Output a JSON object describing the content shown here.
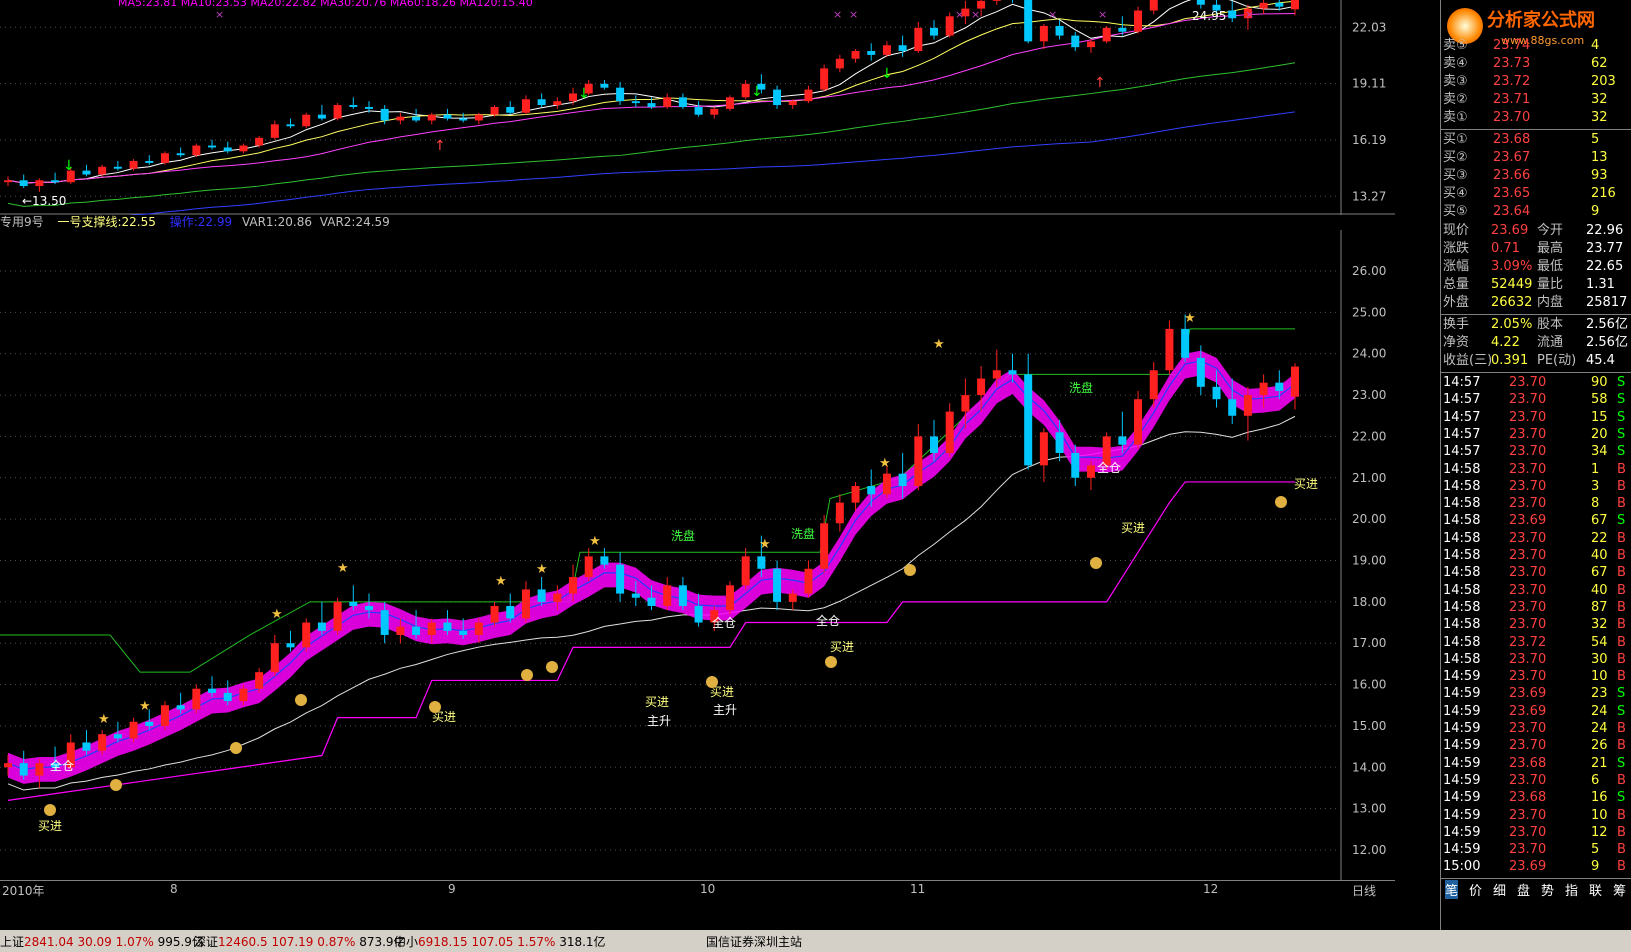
{
  "top_legend": {
    "ma_text": "MA5:23.81  MA10:23.53  MA20:22.82  MA30:20.76  MA60:18.26  MA120:15.40"
  },
  "indicator_legend": {
    "name": "专用9号",
    "support": "一号支撑线:22.55",
    "op": "操作:22.99",
    "var1": "VAR1:20.86",
    "var2": "VAR2:24.59"
  },
  "top_price_axis": [
    "22.03",
    "19.11",
    "16.19",
    "13.27"
  ],
  "main_price_axis": [
    "26.00",
    "25.00",
    "24.00",
    "23.00",
    "22.00",
    "21.00",
    "20.00",
    "19.00",
    "18.00",
    "17.00",
    "16.00",
    "15.00",
    "14.00",
    "13.00",
    "12.00"
  ],
  "low_label": "←13.50",
  "high_label": "24.95",
  "date_axis": [
    "2010年",
    "8",
    "9",
    "10",
    "11",
    "12"
  ],
  "date_axis_right": "日线",
  "annotations": {
    "buy": "买进",
    "full": "全仓",
    "wash": "洗盘",
    "main_rise": "主升"
  },
  "brand": {
    "name": "分析家公式网",
    "url": "www.88gs.com"
  },
  "order_book": {
    "sell": [
      {
        "label": "卖⑤",
        "price": "23.74",
        "vol": "4"
      },
      {
        "label": "卖④",
        "price": "23.73",
        "vol": "62"
      },
      {
        "label": "卖③",
        "price": "23.72",
        "vol": "203"
      },
      {
        "label": "卖②",
        "price": "23.71",
        "vol": "32"
      },
      {
        "label": "卖①",
        "price": "23.70",
        "vol": "32"
      }
    ],
    "buy": [
      {
        "label": "买①",
        "price": "23.68",
        "vol": "5"
      },
      {
        "label": "买②",
        "price": "23.67",
        "vol": "13"
      },
      {
        "label": "买③",
        "price": "23.66",
        "vol": "93"
      },
      {
        "label": "买④",
        "price": "23.65",
        "vol": "216"
      },
      {
        "label": "买⑤",
        "price": "23.64",
        "vol": "9"
      }
    ]
  },
  "stats": [
    {
      "k1": "现价",
      "v1": "23.69",
      "k2": "今开",
      "v2": "22.96"
    },
    {
      "k1": "涨跌",
      "v1": "0.71",
      "k2": "最高",
      "v2": "23.77"
    },
    {
      "k1": "涨幅",
      "v1": "3.09%",
      "k2": "最低",
      "v2": "22.65"
    },
    {
      "k1": "总量",
      "v1": "52449",
      "k2": "量比",
      "v2": "1.31"
    },
    {
      "k1": "外盘",
      "v1": "26632",
      "k2": "内盘",
      "v2": "25817"
    },
    {
      "k1": "换手",
      "v1": "2.05%",
      "k2": "股本",
      "v2": "2.56亿"
    },
    {
      "k1": "净资",
      "v1": "4.22",
      "k2": "流通",
      "v2": "2.56亿"
    },
    {
      "k1": "收益(三)",
      "v1": "0.391",
      "k2": "PE(动)",
      "v2": "45.4"
    }
  ],
  "ticks": [
    {
      "t": "14:57",
      "p": "23.70",
      "v": "90",
      "d": "S"
    },
    {
      "t": "14:57",
      "p": "23.70",
      "v": "58",
      "d": "S"
    },
    {
      "t": "14:57",
      "p": "23.70",
      "v": "15",
      "d": "S"
    },
    {
      "t": "14:57",
      "p": "23.70",
      "v": "20",
      "d": "S"
    },
    {
      "t": "14:57",
      "p": "23.70",
      "v": "34",
      "d": "S"
    },
    {
      "t": "14:58",
      "p": "23.70",
      "v": "1",
      "d": "B"
    },
    {
      "t": "14:58",
      "p": "23.70",
      "v": "3",
      "d": "B"
    },
    {
      "t": "14:58",
      "p": "23.70",
      "v": "8",
      "d": "B"
    },
    {
      "t": "14:58",
      "p": "23.69",
      "v": "67",
      "d": "S"
    },
    {
      "t": "14:58",
      "p": "23.70",
      "v": "22",
      "d": "B"
    },
    {
      "t": "14:58",
      "p": "23.70",
      "v": "40",
      "d": "B"
    },
    {
      "t": "14:58",
      "p": "23.70",
      "v": "67",
      "d": "B"
    },
    {
      "t": "14:58",
      "p": "23.70",
      "v": "40",
      "d": "B"
    },
    {
      "t": "14:58",
      "p": "23.70",
      "v": "87",
      "d": "B"
    },
    {
      "t": "14:58",
      "p": "23.70",
      "v": "32",
      "d": "B"
    },
    {
      "t": "14:58",
      "p": "23.72",
      "v": "54",
      "d": "B"
    },
    {
      "t": "14:58",
      "p": "23.70",
      "v": "30",
      "d": "B"
    },
    {
      "t": "14:59",
      "p": "23.70",
      "v": "10",
      "d": "B"
    },
    {
      "t": "14:59",
      "p": "23.69",
      "v": "23",
      "d": "S"
    },
    {
      "t": "14:59",
      "p": "23.69",
      "v": "24",
      "d": "S"
    },
    {
      "t": "14:59",
      "p": "23.70",
      "v": "24",
      "d": "B"
    },
    {
      "t": "14:59",
      "p": "23.70",
      "v": "26",
      "d": "B"
    },
    {
      "t": "14:59",
      "p": "23.68",
      "v": "21",
      "d": "S"
    },
    {
      "t": "14:59",
      "p": "23.70",
      "v": "6",
      "d": "B"
    },
    {
      "t": "14:59",
      "p": "23.68",
      "v": "16",
      "d": "S"
    },
    {
      "t": "14:59",
      "p": "23.70",
      "v": "10",
      "d": "B"
    },
    {
      "t": "14:59",
      "p": "23.70",
      "v": "12",
      "d": "B"
    },
    {
      "t": "14:59",
      "p": "23.70",
      "v": "5",
      "d": "B"
    },
    {
      "t": "15:00",
      "p": "23.69",
      "v": "9",
      "d": "B"
    }
  ],
  "panel_tabs": [
    "笔",
    "价",
    "细",
    "盘",
    "势",
    "指",
    "联",
    "筹"
  ],
  "status_bar": [
    {
      "name": "上证",
      "idx": "2841.04",
      "chg": "30.09",
      "pct": "1.07%",
      "amt": "995.9亿"
    },
    {
      "name": "深证",
      "idx": "12460.5",
      "chg": "107.19",
      "pct": "0.87%",
      "amt": "873.9亿"
    },
    {
      "name": "中小",
      "idx": "6918.15",
      "chg": "107.05",
      "pct": "1.57%",
      "amt": "318.1亿"
    }
  ],
  "broker": "国信证券深圳主站",
  "colors": {
    "up": "#ff2020",
    "down": "#00c8ff",
    "magenta": "#ff00ff",
    "teal": "#1e6a8a",
    "yellow": "#ffff00",
    "green": "#00ff00"
  },
  "candles": [
    {
      "o": 14.0,
      "h": 14.3,
      "l": 13.8,
      "c": 14.1
    },
    {
      "o": 14.1,
      "h": 14.4,
      "l": 13.7,
      "c": 13.8
    },
    {
      "o": 13.8,
      "h": 14.2,
      "l": 13.5,
      "c": 14.1
    },
    {
      "o": 14.1,
      "h": 14.5,
      "l": 13.9,
      "c": 14.0
    },
    {
      "o": 14.0,
      "h": 14.8,
      "l": 13.9,
      "c": 14.6
    },
    {
      "o": 14.6,
      "h": 14.9,
      "l": 14.3,
      "c": 14.4
    },
    {
      "o": 14.4,
      "h": 14.9,
      "l": 14.3,
      "c": 14.8
    },
    {
      "o": 14.8,
      "h": 15.1,
      "l": 14.6,
      "c": 14.7
    },
    {
      "o": 14.7,
      "h": 15.2,
      "l": 14.6,
      "c": 15.1
    },
    {
      "o": 15.1,
      "h": 15.4,
      "l": 14.9,
      "c": 15.0
    },
    {
      "o": 15.0,
      "h": 15.6,
      "l": 14.9,
      "c": 15.5
    },
    {
      "o": 15.5,
      "h": 15.8,
      "l": 15.3,
      "c": 15.4
    },
    {
      "o": 15.4,
      "h": 16.0,
      "l": 15.3,
      "c": 15.9
    },
    {
      "o": 15.9,
      "h": 16.2,
      "l": 15.7,
      "c": 15.8
    },
    {
      "o": 15.8,
      "h": 16.1,
      "l": 15.5,
      "c": 15.6
    },
    {
      "o": 15.6,
      "h": 16.0,
      "l": 15.5,
      "c": 15.9
    },
    {
      "o": 15.9,
      "h": 16.4,
      "l": 15.8,
      "c": 16.3
    },
    {
      "o": 16.3,
      "h": 17.2,
      "l": 16.2,
      "c": 17.0
    },
    {
      "o": 17.0,
      "h": 17.3,
      "l": 16.8,
      "c": 16.9
    },
    {
      "o": 16.9,
      "h": 17.6,
      "l": 16.8,
      "c": 17.5
    },
    {
      "o": 17.5,
      "h": 18.0,
      "l": 17.2,
      "c": 17.3
    },
    {
      "o": 17.3,
      "h": 18.1,
      "l": 17.2,
      "c": 18.0
    },
    {
      "o": 18.0,
      "h": 18.4,
      "l": 17.8,
      "c": 17.9
    },
    {
      "o": 17.9,
      "h": 18.2,
      "l": 17.6,
      "c": 17.8
    },
    {
      "o": 17.8,
      "h": 18.0,
      "l": 17.0,
      "c": 17.2
    },
    {
      "o": 17.2,
      "h": 17.6,
      "l": 17.0,
      "c": 17.4
    },
    {
      "o": 17.4,
      "h": 17.8,
      "l": 17.1,
      "c": 17.2
    },
    {
      "o": 17.2,
      "h": 17.6,
      "l": 17.0,
      "c": 17.5
    },
    {
      "o": 17.5,
      "h": 17.8,
      "l": 17.2,
      "c": 17.3
    },
    {
      "o": 17.3,
      "h": 17.6,
      "l": 17.1,
      "c": 17.2
    },
    {
      "o": 17.2,
      "h": 17.6,
      "l": 17.0,
      "c": 17.5
    },
    {
      "o": 17.5,
      "h": 18.0,
      "l": 17.4,
      "c": 17.9
    },
    {
      "o": 17.9,
      "h": 18.2,
      "l": 17.5,
      "c": 17.6
    },
    {
      "o": 17.6,
      "h": 18.5,
      "l": 17.5,
      "c": 18.3
    },
    {
      "o": 18.3,
      "h": 18.6,
      "l": 17.9,
      "c": 18.0
    },
    {
      "o": 18.0,
      "h": 18.4,
      "l": 17.8,
      "c": 18.2
    },
    {
      "o": 18.2,
      "h": 18.9,
      "l": 18.0,
      "c": 18.6
    },
    {
      "o": 18.6,
      "h": 19.3,
      "l": 18.5,
      "c": 19.1
    },
    {
      "o": 19.1,
      "h": 19.3,
      "l": 18.8,
      "c": 18.9
    },
    {
      "o": 18.9,
      "h": 19.2,
      "l": 18.0,
      "c": 18.2
    },
    {
      "o": 18.2,
      "h": 18.5,
      "l": 17.9,
      "c": 18.1
    },
    {
      "o": 18.1,
      "h": 18.4,
      "l": 17.8,
      "c": 17.9
    },
    {
      "o": 17.9,
      "h": 18.6,
      "l": 17.8,
      "c": 18.4
    },
    {
      "o": 18.4,
      "h": 18.6,
      "l": 17.8,
      "c": 17.9
    },
    {
      "o": 17.9,
      "h": 18.2,
      "l": 17.4,
      "c": 17.5
    },
    {
      "o": 17.5,
      "h": 17.9,
      "l": 17.3,
      "c": 17.8
    },
    {
      "o": 17.8,
      "h": 18.5,
      "l": 17.7,
      "c": 18.4
    },
    {
      "o": 18.4,
      "h": 19.3,
      "l": 18.3,
      "c": 19.1
    },
    {
      "o": 19.1,
      "h": 19.6,
      "l": 18.6,
      "c": 18.8
    },
    {
      "o": 18.8,
      "h": 19.0,
      "l": 17.8,
      "c": 18.0
    },
    {
      "o": 18.0,
      "h": 18.3,
      "l": 17.8,
      "c": 18.2
    },
    {
      "o": 18.2,
      "h": 19.0,
      "l": 18.1,
      "c": 18.8
    },
    {
      "o": 18.8,
      "h": 20.1,
      "l": 18.7,
      "c": 19.9
    },
    {
      "o": 19.9,
      "h": 20.6,
      "l": 19.7,
      "c": 20.4
    },
    {
      "o": 20.4,
      "h": 20.9,
      "l": 20.2,
      "c": 20.8
    },
    {
      "o": 20.8,
      "h": 21.2,
      "l": 20.3,
      "c": 20.6
    },
    {
      "o": 20.6,
      "h": 21.3,
      "l": 20.5,
      "c": 21.1
    },
    {
      "o": 21.1,
      "h": 21.6,
      "l": 20.5,
      "c": 20.8
    },
    {
      "o": 20.8,
      "h": 22.3,
      "l": 20.7,
      "c": 22.0
    },
    {
      "o": 22.0,
      "h": 22.4,
      "l": 21.4,
      "c": 21.6
    },
    {
      "o": 21.6,
      "h": 22.8,
      "l": 21.5,
      "c": 22.6
    },
    {
      "o": 22.6,
      "h": 23.4,
      "l": 22.2,
      "c": 23.0
    },
    {
      "o": 23.0,
      "h": 23.7,
      "l": 22.6,
      "c": 23.4
    },
    {
      "o": 23.4,
      "h": 24.1,
      "l": 23.2,
      "c": 23.6
    },
    {
      "o": 23.6,
      "h": 24.0,
      "l": 23.3,
      "c": 23.5
    },
    {
      "o": 23.5,
      "h": 24.0,
      "l": 21.2,
      "c": 21.3
    },
    {
      "o": 21.3,
      "h": 22.2,
      "l": 20.9,
      "c": 22.1
    },
    {
      "o": 22.1,
      "h": 22.4,
      "l": 21.4,
      "c": 21.6
    },
    {
      "o": 21.6,
      "h": 21.8,
      "l": 20.8,
      "c": 21.0
    },
    {
      "o": 21.0,
      "h": 21.4,
      "l": 20.7,
      "c": 21.3
    },
    {
      "o": 21.3,
      "h": 22.1,
      "l": 21.2,
      "c": 22.0
    },
    {
      "o": 22.0,
      "h": 22.6,
      "l": 21.6,
      "c": 21.8
    },
    {
      "o": 21.8,
      "h": 23.1,
      "l": 21.7,
      "c": 22.9
    },
    {
      "o": 22.9,
      "h": 23.8,
      "l": 22.7,
      "c": 23.6
    },
    {
      "o": 23.6,
      "h": 24.8,
      "l": 23.5,
      "c": 24.6
    },
    {
      "o": 24.6,
      "h": 24.95,
      "l": 23.8,
      "c": 23.9
    },
    {
      "o": 23.9,
      "h": 24.2,
      "l": 23.0,
      "c": 23.2
    },
    {
      "o": 23.2,
      "h": 23.6,
      "l": 22.7,
      "c": 22.9
    },
    {
      "o": 22.9,
      "h": 23.4,
      "l": 22.3,
      "c": 22.5
    },
    {
      "o": 22.5,
      "h": 23.2,
      "l": 21.9,
      "c": 23.0
    },
    {
      "o": 23.0,
      "h": 23.5,
      "l": 22.7,
      "c": 23.3
    },
    {
      "o": 23.3,
      "h": 23.6,
      "l": 22.9,
      "c": 23.1
    },
    {
      "o": 22.96,
      "h": 23.77,
      "l": 22.65,
      "c": 23.69
    }
  ]
}
